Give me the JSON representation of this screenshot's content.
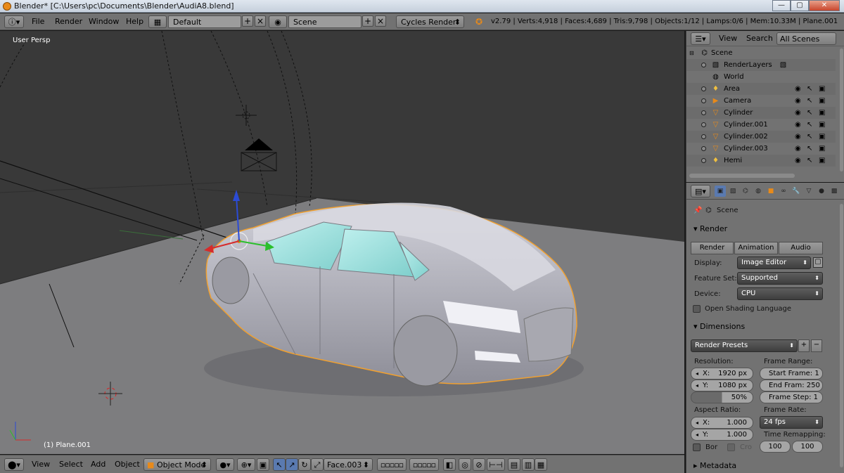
{
  "window": {
    "title": "Blender* [C:\\Users\\pc\\Documents\\Blender\\AudiA8.blend]",
    "min": "—",
    "max": "▢",
    "close": "✕"
  },
  "infobar": {
    "menus": [
      "File",
      "Render",
      "Window",
      "Help"
    ],
    "screen_layout": "Default",
    "scene": "Scene",
    "engine": "Cycles Render",
    "stats": "v2.79 | Verts:4,918 | Faces:4,689 | Tris:9,798 | Objects:1/12 | Lamps:0/6 | Mem:10.33M | Plane.001"
  },
  "viewport": {
    "view_label": "User Persp",
    "object_label": "(1) Plane.001"
  },
  "view3d_header": {
    "menus": [
      "View",
      "Select",
      "Add",
      "Object"
    ],
    "mode": "Object Mode",
    "orientation": "Face.003"
  },
  "outliner": {
    "menus": [
      "View",
      "Search"
    ],
    "filter": "All Scenes",
    "items": [
      {
        "name": "Scene",
        "icon": "scene-icon"
      },
      {
        "name": "RenderLayers",
        "icon": "renderlayers-icon"
      },
      {
        "name": "World",
        "icon": "world-icon"
      },
      {
        "name": "Area",
        "icon": "lamp-icon"
      },
      {
        "name": "Camera",
        "icon": "camera-icon"
      },
      {
        "name": "Cylinder",
        "icon": "mesh-icon"
      },
      {
        "name": "Cylinder.001",
        "icon": "mesh-icon"
      },
      {
        "name": "Cylinder.002",
        "icon": "mesh-icon"
      },
      {
        "name": "Cylinder.003",
        "icon": "mesh-icon"
      },
      {
        "name": "Hemi",
        "icon": "lamp-icon"
      }
    ]
  },
  "properties": {
    "scene": "Scene",
    "render_panel": {
      "title": "Render",
      "buttons": [
        "Render",
        "Animation",
        "Audio"
      ],
      "display_label": "Display:",
      "display": "Image Editor",
      "feature_label": "Feature Set:",
      "feature": "Supported",
      "device_label": "Device:",
      "device": "CPU",
      "osl": "Open Shading Language"
    },
    "dimensions_panel": {
      "title": "Dimensions",
      "presets": "Render Presets",
      "resolution_label": "Resolution:",
      "res_x_label": "X:",
      "res_x": "1920 px",
      "res_y_label": "Y:",
      "res_y": "1080 px",
      "res_pct": "50%",
      "frame_range_label": "Frame Range:",
      "start_frame": "Start Frame: 1",
      "end_frame": "End Fram: 250",
      "frame_step": "Frame Step: 1",
      "aspect_label": "Aspect Ratio:",
      "aspect_x_label": "X:",
      "aspect_x": "1.000",
      "aspect_y_label": "Y:",
      "aspect_y": "1.000",
      "frame_rate_label": "Frame Rate:",
      "frame_rate": "24 fps",
      "remap_label": "Time Remapping:",
      "remap_old": "100",
      "remap_new": "100",
      "border": "Bor",
      "crop": "Cro"
    },
    "metadata_title": "Metadata"
  },
  "colors": {
    "accent": "#e88a1a",
    "selection_outline": "#f0a030",
    "viewport_bg": "#393939",
    "ui_gray": "#727272"
  }
}
